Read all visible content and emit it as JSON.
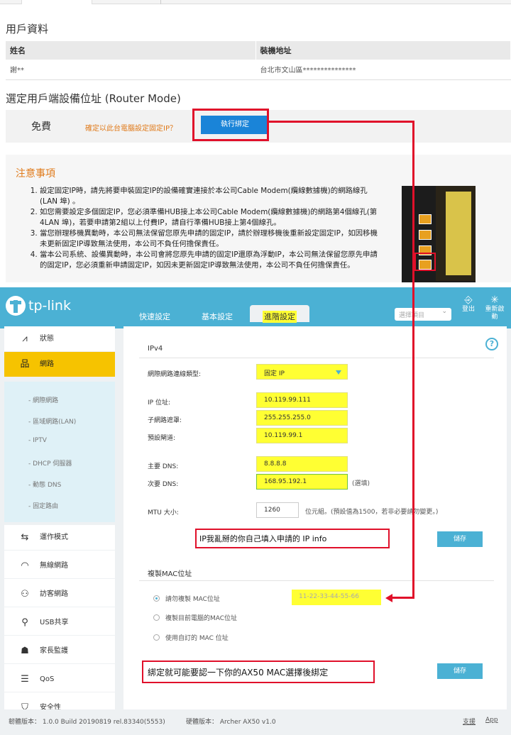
{
  "user_info": {
    "title": "用戶資料",
    "headers": [
      "姓名",
      "裝機地址"
    ],
    "row": [
      "謝**",
      "台北市文山區***************"
    ]
  },
  "router": {
    "title": "選定用戶端設備位址 (Router Mode)",
    "free_label": "免費",
    "question": "確定以此台電腦設定固定IP？",
    "bind_button": "執行綁定"
  },
  "notes": {
    "title": "注意事項",
    "items": [
      "設定固定IP時，請先將要申裝固定IP的設備確實連接於本公司Cable Modem(纜線數據機)的網路線孔(LAN 埠) 。",
      "如您需要設定多個固定IP，您必須準備HUB接上本公司Cable Modem(纜線數據機)的網路第4個線孔(第4LAN 埠)，若要申請第2組以上付費IP，請自行準備HUB接上第4個線孔。",
      "當您辦理移機異動時，本公司無法保留您原先申請的固定IP，請於辦理移機後重新設定固定IP，如因移機未更新固定IP導致無法使用，本公司不負任何擔保責任。",
      "當本公司系統、設備異動時，本公司會將您原先申請的固定IP還原為浮動IP，本公司無法保留您原先申請的固定IP，您必須重新申請固定IP，如因未更新固定IP導致無法使用，本公司不負任何擔保責任。"
    ]
  },
  "tplink": {
    "logo": "tp-link",
    "tabs": [
      "快速設定",
      "基本設定",
      "進階設定"
    ],
    "select_placeholder": "選擇項目",
    "logout": "登出",
    "reboot": "重新啟動",
    "sidebar_top": [
      {
        "icon": "pulse-icon",
        "glyph": "⩘",
        "label": "狀態"
      },
      {
        "icon": "network-icon",
        "glyph": "品",
        "label": "網路"
      }
    ],
    "sub_items": [
      "- 網際網路",
      "- 區域網路(LAN)",
      "- IPTV",
      "- DHCP 伺服器",
      "- 動態 DNS",
      "- 固定路由"
    ],
    "sidebar_bottom": [
      {
        "icon": "mode-icon",
        "glyph": "⇆",
        "label": "運作模式"
      },
      {
        "icon": "wifi-icon",
        "glyph": "◠",
        "label": "無線網路"
      },
      {
        "icon": "guest-icon",
        "glyph": "⚇",
        "label": "訪客網路"
      },
      {
        "icon": "usb-icon",
        "glyph": "⚲",
        "label": "USB共享"
      },
      {
        "icon": "parental-icon",
        "glyph": "☗",
        "label": "家長監護"
      },
      {
        "icon": "qos-icon",
        "glyph": "☰",
        "label": "QoS"
      },
      {
        "icon": "security-icon",
        "glyph": "⛉",
        "label": "安全性"
      }
    ],
    "ipv4_title": "IPv4",
    "conn_type_label": "網際網路連線類型:",
    "conn_type_value": "固定 IP",
    "ip_label": "IP 位址:",
    "ip_value": "10.119.99.111",
    "mask_label": "子網路遮罩:",
    "mask_value": "255.255.255.0",
    "gateway_label": "預設閘道:",
    "gateway_value": "10.119.99.1",
    "dns1_label": "主要 DNS:",
    "dns1_value": "8.8.8.8",
    "dns2_label": "次要 DNS:",
    "dns2_value": "168.95.192.1",
    "optional": "(選填)",
    "mtu_label": "MTU 大小:",
    "mtu_value": "1260",
    "mtu_note": "位元組。(預設值為1500，若非必要請勿變更。)",
    "annotation1": "IP我亂掰的你自己填入申請的 IP info",
    "save": "儲存",
    "mac_title": "複製MAC位址",
    "mac_opt1": "請勿複製 MAC位址",
    "mac_value": "11-22-33-44-55-66",
    "mac_opt2": "複製目前電腦的MAC位址",
    "mac_opt3": "使用自訂的 MAC 位址",
    "annotation2": "綁定就可能要認一下你的AX50 MAC選擇後綁定",
    "firmware": "韌體版本： 1.0.0 Build 20190819 rel.83340(5553)",
    "hardware": "硬體版本： Archer AX50 v1.0",
    "support": "支援",
    "app": "App"
  }
}
